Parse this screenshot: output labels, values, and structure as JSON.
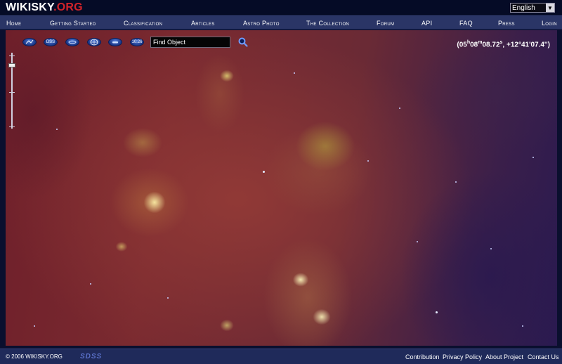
{
  "logo": {
    "name": "WIKISKY",
    "tld": ".ORG"
  },
  "language": {
    "selected": "English"
  },
  "nav": {
    "items": [
      {
        "label": "Home"
      },
      {
        "label": "Getting Started"
      },
      {
        "label": "Classification"
      },
      {
        "label": "Articles"
      },
      {
        "label": "Astro Photo"
      },
      {
        "label": "The Collection"
      },
      {
        "label": "Forum"
      },
      {
        "label": "API"
      },
      {
        "label": "FAQ"
      },
      {
        "label": "Press"
      },
      {
        "label": "Login"
      }
    ]
  },
  "toolbar": {
    "tools": [
      {
        "icon": "constellation-icon",
        "label": ""
      },
      {
        "icon": "dss-survey-icon",
        "label": "DSS"
      },
      {
        "icon": "galaxy-icon",
        "label": ""
      },
      {
        "icon": "grid-globe-icon",
        "label": ""
      },
      {
        "icon": "telescope-icon",
        "label": ""
      },
      {
        "icon": "time-icon",
        "label": "10:26"
      }
    ],
    "search_placeholder": "Find Object"
  },
  "coordinates": {
    "open": "(05",
    "h": "h",
    "mm": "08",
    "m": "m",
    "sec": "08.72",
    "s": "s",
    "dec": ", +12°41'07.4'')"
  },
  "footer": {
    "copyright": "© 2006 WIKISKY.ORG",
    "sdss_logo": "SDSS",
    "links": [
      {
        "label": "Contribution"
      },
      {
        "label": "Privacy Policy"
      },
      {
        "label": "About Project"
      },
      {
        "label": "Contact Us"
      }
    ]
  },
  "colors": {
    "header_bg": "#050b26",
    "nav_bg": "#2a3566",
    "footer_bg": "#1f2a5a",
    "logo_accent": "#d2232a"
  }
}
